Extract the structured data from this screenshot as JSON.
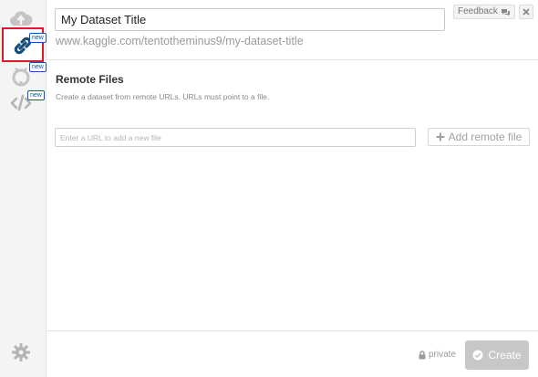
{
  "sidebar": {
    "badge_label": "new",
    "items": [
      {
        "name": "upload",
        "icon": "cloud-upload-icon"
      },
      {
        "name": "remote-urls",
        "icon": "link-icon",
        "active": true
      },
      {
        "name": "github",
        "icon": "github-icon"
      },
      {
        "name": "code",
        "icon": "code-icon"
      }
    ],
    "settings_icon": "gear-icon"
  },
  "header": {
    "title_value": "My Dataset Title",
    "url": "www.kaggle.com/tentotheminus9/my-dataset-title",
    "feedback_label": "Feedback",
    "feedback_icon": "comments-icon",
    "close_icon": "close-icon"
  },
  "remote_files": {
    "title": "Remote Files",
    "description": "Create a dataset from remote URLs. URLs must point to a file.",
    "url_placeholder": "Enter a URL to add a new file",
    "add_label": "Add remote file"
  },
  "footer": {
    "privacy_label": "private",
    "create_label": "Create"
  },
  "colors": {
    "active_border": "#d41f26",
    "link_icon": "#1a4e7a",
    "badge": "#1a4ea8",
    "disabled_button": "#c7c7c7"
  }
}
